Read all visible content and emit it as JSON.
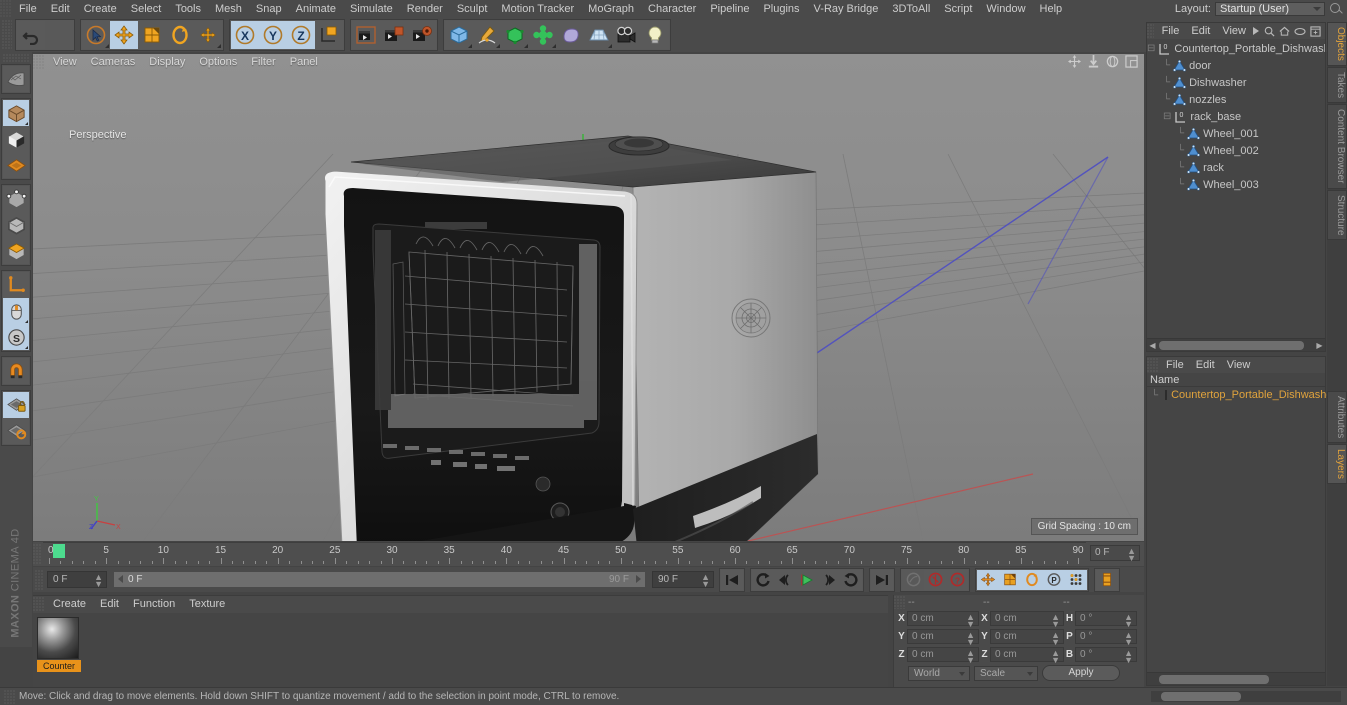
{
  "app": {
    "title": "MAXON CINEMA 4D",
    "logo_line1": "MAXON",
    "logo_line2": "CINEMA 4D"
  },
  "menubar": {
    "items": [
      "File",
      "Edit",
      "Create",
      "Select",
      "Tools",
      "Mesh",
      "Snap",
      "Animate",
      "Simulate",
      "Render",
      "Sculpt",
      "Motion Tracker",
      "MoGraph",
      "Character",
      "Pipeline",
      "Plugins",
      "V-Ray Bridge",
      "3DToAll",
      "Script",
      "Window",
      "Help"
    ],
    "layout_label": "Layout:",
    "layout_value": "Startup (User)",
    "search_icon": "search-icon"
  },
  "toolbar": {
    "groups": [
      {
        "buttons": [
          {
            "name": "undo-button",
            "icon": "undo-arrow-icon",
            "state": "normal"
          },
          {
            "name": "redo-button",
            "icon": "redo-arrow-icon",
            "state": "disabled"
          }
        ]
      },
      {
        "buttons": [
          {
            "name": "live-selection-tool",
            "icon": "cursor-circle-icon",
            "state": "normal"
          },
          {
            "name": "move-tool",
            "icon": "move-arrows-icon",
            "state": "selected"
          },
          {
            "name": "scale-tool",
            "icon": "scale-box-icon",
            "state": "normal"
          },
          {
            "name": "rotate-tool",
            "icon": "rotate-ring-icon",
            "state": "normal"
          },
          {
            "name": "move-axis-tool",
            "icon": "move-plus-icon",
            "state": "normal"
          }
        ]
      },
      {
        "buttons": [
          {
            "name": "lock-x-axis",
            "icon": "x-axis-icon",
            "state": "selected",
            "label": "X"
          },
          {
            "name": "lock-y-axis",
            "icon": "y-axis-icon",
            "state": "selected",
            "label": "Y"
          },
          {
            "name": "lock-z-axis",
            "icon": "z-axis-icon",
            "state": "selected",
            "label": "Z"
          },
          {
            "name": "world-object-coord-toggle",
            "icon": "world-axis-cube-icon",
            "state": "normal"
          }
        ]
      },
      {
        "buttons": [
          {
            "name": "render-view-button",
            "icon": "render-clapper-icon",
            "state": "normal"
          },
          {
            "name": "render-to-picture-viewer-button",
            "icon": "render-picture-icon",
            "state": "normal"
          },
          {
            "name": "render-settings-button",
            "icon": "render-settings-icon",
            "state": "normal"
          }
        ]
      },
      {
        "buttons": [
          {
            "name": "primitive-cube-button",
            "icon": "blue-cube-icon",
            "state": "normal"
          },
          {
            "name": "spline-pen-button",
            "icon": "pen-spline-icon",
            "state": "normal"
          },
          {
            "name": "generator-button",
            "icon": "green-cube-icon",
            "state": "normal"
          },
          {
            "name": "deformer-button",
            "icon": "bend-deformer-icon",
            "state": "normal"
          },
          {
            "name": "environment-button",
            "icon": "sky-blob-icon",
            "state": "normal"
          },
          {
            "name": "floor-button",
            "icon": "grid-floor-icon",
            "state": "normal"
          },
          {
            "name": "camera-button",
            "icon": "camera-icon",
            "state": "normal"
          },
          {
            "name": "light-button",
            "icon": "light-bulb-icon",
            "state": "normal"
          }
        ]
      }
    ]
  },
  "left_toolbar": {
    "buttons": [
      {
        "name": "make-editable-button",
        "icon": "make-editable-icon",
        "state": "normal"
      },
      {
        "name": "model-mode-button",
        "icon": "model-cube-icon",
        "state": "selected"
      },
      {
        "name": "texture-mode-button",
        "icon": "texture-cube-icon",
        "state": "normal"
      },
      {
        "name": "workplane-mode-button",
        "icon": "workplane-grid-icon",
        "state": "normal"
      },
      {
        "name": "point-mode-button",
        "icon": "points-cube-icon",
        "state": "normal"
      },
      {
        "name": "edge-mode-button",
        "icon": "edge-cube-icon",
        "state": "normal"
      },
      {
        "name": "polygon-mode-button",
        "icon": "polygon-cube-icon",
        "state": "normal"
      },
      {
        "name": "axis-modify-button",
        "icon": "axis-l-icon",
        "state": "normal"
      },
      {
        "name": "viewport-solo-button",
        "icon": "mouse-icon",
        "state": "selected"
      },
      {
        "name": "snap-settings-button",
        "icon": "s-circle-icon",
        "state": "selected"
      },
      {
        "name": "enable-snap-button",
        "icon": "magnet-icon",
        "state": "normal"
      },
      {
        "name": "workplane-lock-button",
        "icon": "grid-lock-icon",
        "state": "selected"
      },
      {
        "name": "workplane-reset-button",
        "icon": "grid-reset-icon",
        "state": "normal"
      }
    ]
  },
  "viewport": {
    "menu_items": [
      "View",
      "Cameras",
      "Display",
      "Options",
      "Filter",
      "Panel"
    ],
    "camera_label": "Perspective",
    "grid_spacing": "Grid Spacing : 10 cm",
    "nav_icons": [
      "pan-icon",
      "dolly-icon",
      "orbit-icon",
      "maximize-icon"
    ],
    "axis_labels": {
      "x": "X",
      "y": "Y",
      "z": "Z"
    }
  },
  "timeline": {
    "start": 0,
    "end": 90,
    "major_step": 5,
    "tick_labels": [
      0,
      5,
      10,
      15,
      20,
      25,
      30,
      35,
      40,
      45,
      50,
      55,
      60,
      65,
      70,
      75,
      80,
      85,
      90
    ],
    "current_frame_field": "0 F",
    "playhead_frame": 0
  },
  "playback": {
    "current_frame": "0 F",
    "preview_min": "0 F",
    "preview_max": "90 F",
    "max_frame": "90 F",
    "buttons": [
      {
        "name": "go-to-start-button",
        "icon": "skip-start-icon",
        "state": "normal"
      },
      {
        "name": "previous-key-button",
        "icon": "rewind-key-icon",
        "state": "normal"
      },
      {
        "name": "step-back-button",
        "icon": "step-back-icon",
        "state": "normal"
      },
      {
        "name": "play-button",
        "icon": "play-triangle-icon",
        "state": "normal"
      },
      {
        "name": "step-forward-button",
        "icon": "step-forward-icon",
        "state": "normal"
      },
      {
        "name": "next-key-button",
        "icon": "forward-key-icon",
        "state": "normal"
      },
      {
        "name": "go-to-end-button",
        "icon": "skip-end-icon",
        "state": "normal"
      },
      {
        "name": "autokey-toggle-button",
        "icon": "autokey-icon",
        "state": "disabled"
      },
      {
        "name": "record-active-objects-button",
        "icon": "record-circle-icon",
        "state": "normal"
      },
      {
        "name": "keyframe-selection-button",
        "icon": "question-circle-icon",
        "state": "normal"
      },
      {
        "name": "record-position-button",
        "icon": "position-arrows-icon",
        "state": "selected"
      },
      {
        "name": "record-scale-button",
        "icon": "scale-orange-icon",
        "state": "selected"
      },
      {
        "name": "record-rotation-button",
        "icon": "rotation-orange-icon",
        "state": "selected"
      },
      {
        "name": "record-parameter-button",
        "icon": "p-circle-icon",
        "state": "selected"
      },
      {
        "name": "record-pla-button",
        "icon": "pla-dots-icon",
        "state": "selected"
      },
      {
        "name": "keyframe-mode-button",
        "icon": "keyframe-mode-icon",
        "state": "normal"
      }
    ]
  },
  "material_panel": {
    "menu_items": [
      "Create",
      "Edit",
      "Function",
      "Texture"
    ],
    "materials": [
      {
        "name": "Counter",
        "label": "Counter"
      }
    ]
  },
  "coordinates": {
    "headers": [
      "--",
      "--",
      "--"
    ],
    "rows": [
      {
        "axis": "X",
        "position": "0 cm",
        "size": "0 cm",
        "rot_label": "H",
        "rotation": "0 °"
      },
      {
        "axis": "Y",
        "position": "0 cm",
        "size": "0 cm",
        "rot_label": "P",
        "rotation": "0 °"
      },
      {
        "axis": "Z",
        "position": "0 cm",
        "size": "0 cm",
        "rot_label": "B",
        "rotation": "0 °"
      }
    ],
    "coord_system": "World",
    "size_mode": "Scale",
    "apply_label": "Apply"
  },
  "object_manager": {
    "menu_items": [
      "File",
      "Edit",
      "View"
    ],
    "header_icons": [
      "play-arrow-icon",
      "search-icon",
      "home-icon",
      "eye-icon",
      "fit-icon"
    ],
    "tree": [
      {
        "label": "Countertop_Portable_Dishwasher_",
        "depth": 0,
        "type": "null",
        "expanded": true
      },
      {
        "label": "door",
        "depth": 1,
        "type": "polygon"
      },
      {
        "label": "Dishwasher",
        "depth": 1,
        "type": "polygon"
      },
      {
        "label": "nozzles",
        "depth": 1,
        "type": "polygon"
      },
      {
        "label": "rack_base",
        "depth": 1,
        "type": "null",
        "expanded": true
      },
      {
        "label": "Wheel_001",
        "depth": 2,
        "type": "polygon"
      },
      {
        "label": "Wheel_002",
        "depth": 2,
        "type": "polygon"
      },
      {
        "label": "rack",
        "depth": 2,
        "type": "polygon"
      },
      {
        "label": "Wheel_003",
        "depth": 2,
        "type": "polygon"
      }
    ]
  },
  "layer_manager": {
    "menu_items": [
      "File",
      "Edit",
      "View"
    ],
    "column_header": "Name",
    "rows": [
      {
        "label": "Countertop_Portable_Dishwasher",
        "color": "#e08a20"
      }
    ]
  },
  "vertical_tabs_top": [
    {
      "label": "Objects",
      "selected": true
    },
    {
      "label": "Takes",
      "selected": false
    },
    {
      "label": "Content Browser",
      "selected": false
    },
    {
      "label": "Structure",
      "selected": false
    }
  ],
  "vertical_tabs_bottom": [
    {
      "label": "Attributes",
      "selected": false
    },
    {
      "label": "Layers",
      "selected": true
    }
  ],
  "statusbar": {
    "message": "Move: Click and drag to move elements. Hold down SHIFT to quantize movement / add to the selection in point mode, CTRL to remove."
  },
  "colors": {
    "accent_orange": "#e8921a",
    "selected_blue": "#b9cfe4",
    "panel_bg": "#4a4a4a",
    "viewport_bg": "#868686",
    "green_play": "#3fbf5c",
    "axis_x_red": "#c84040",
    "axis_y_green": "#40c840",
    "axis_z_blue": "#4040c8"
  }
}
